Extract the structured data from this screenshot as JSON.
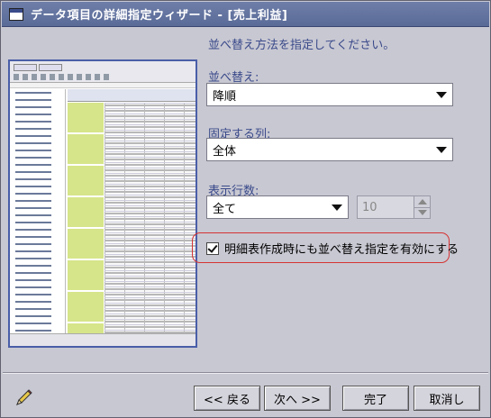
{
  "window": {
    "title": "データ項目の詳細指定ウィザード - [売上利益]"
  },
  "instruction": "並べ替え方法を指定してください。",
  "sort": {
    "label": "並べ替え:",
    "value": "降順"
  },
  "fixed_column": {
    "label": "固定する列:",
    "value": "全体"
  },
  "display_rows": {
    "label": "表示行数:",
    "value": "全て",
    "spinner_value": "10"
  },
  "apply_in_detail": {
    "label": "明細表作成時にも並べ替え指定を有効にする",
    "checked": true
  },
  "buttons": {
    "back": "<< 戻る",
    "next": "次へ >>",
    "finish": "完了",
    "cancel": "取消し"
  },
  "colors": {
    "title_bar": "#5a6b98",
    "label_text": "#3a4a8a",
    "highlight": "#d63333",
    "preview_border": "#4a5ea8",
    "preview_row_header": "#d6e58a"
  }
}
